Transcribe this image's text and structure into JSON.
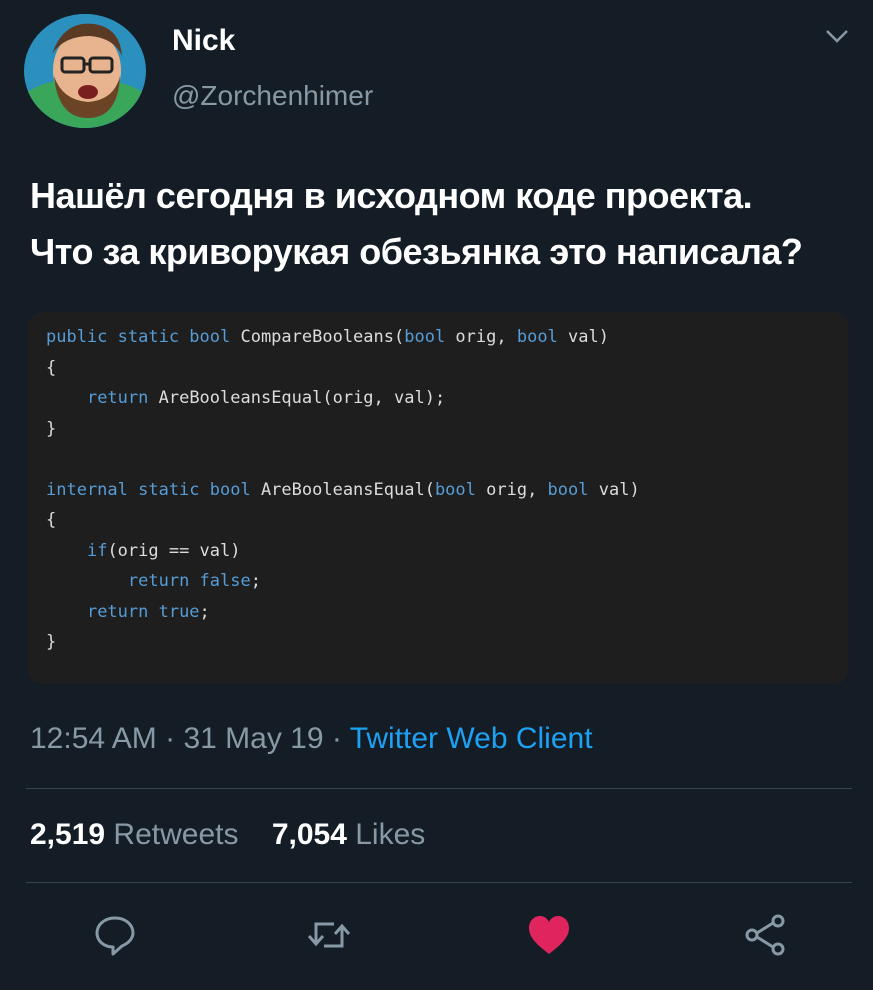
{
  "tweet": {
    "author": {
      "name": "Nick",
      "handle": "@Zorchenhimer"
    },
    "text_lines": [
      "Нашёл сегодня в исходном коде проекта.",
      "Что за криворукая обезьянка это написала?"
    ],
    "code_lines": [
      [
        {
          "t": "public static bool",
          "k": true
        },
        {
          "t": " CompareBooleans(",
          "k": false
        },
        {
          "t": "bool",
          "k": true
        },
        {
          "t": " orig, ",
          "k": false
        },
        {
          "t": "bool",
          "k": true
        },
        {
          "t": " val)",
          "k": false
        }
      ],
      [
        {
          "t": "{",
          "k": false
        }
      ],
      [
        {
          "t": "    ",
          "k": false
        },
        {
          "t": "return",
          "k": true
        },
        {
          "t": " AreBooleansEqual(orig, val);",
          "k": false
        }
      ],
      [
        {
          "t": "}",
          "k": false
        }
      ],
      [
        {
          "t": "",
          "k": false
        }
      ],
      [
        {
          "t": "internal static bool",
          "k": true
        },
        {
          "t": " AreBooleansEqual(",
          "k": false
        },
        {
          "t": "bool",
          "k": true
        },
        {
          "t": " orig, ",
          "k": false
        },
        {
          "t": "bool",
          "k": true
        },
        {
          "t": " val)",
          "k": false
        }
      ],
      [
        {
          "t": "{",
          "k": false
        }
      ],
      [
        {
          "t": "    ",
          "k": false
        },
        {
          "t": "if",
          "k": true
        },
        {
          "t": "(orig == val)",
          "k": false
        }
      ],
      [
        {
          "t": "        ",
          "k": false
        },
        {
          "t": "return false",
          "k": true
        },
        {
          "t": ";",
          "k": false
        }
      ],
      [
        {
          "t": "    ",
          "k": false
        },
        {
          "t": "return true",
          "k": true
        },
        {
          "t": ";",
          "k": false
        }
      ],
      [
        {
          "t": "}",
          "k": false
        }
      ]
    ],
    "time": "12:54 AM",
    "date": "31 May 19",
    "sep": "·",
    "source": "Twitter Web Client",
    "retweets_count": "2,519",
    "retweets_label": "Retweets",
    "likes_count": "7,054",
    "likes_label": "Likes"
  },
  "icons": {
    "menu": "chevron-down-icon",
    "reply": "reply-icon",
    "retweet": "retweet-icon",
    "like": "heart-icon",
    "share": "share-icon"
  },
  "colors": {
    "background": "#141d26",
    "secondary_text": "#8899a6",
    "link": "#1da1f2",
    "like": "#e0245e",
    "code_keyword": "#569cd6"
  }
}
